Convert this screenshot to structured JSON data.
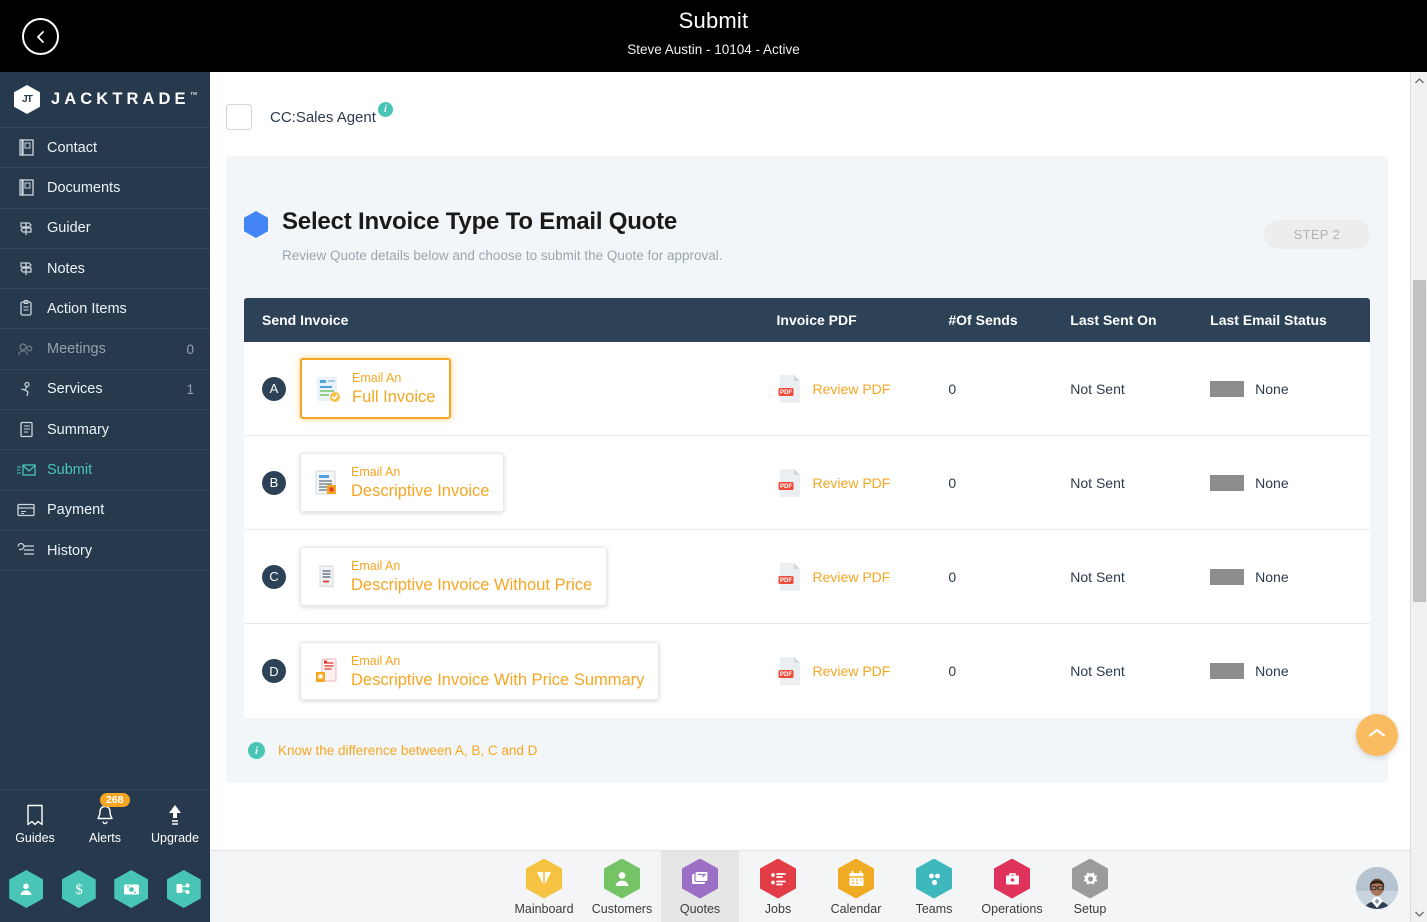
{
  "topbar": {
    "back_icon": "chevron-left-icon",
    "title": "Submit",
    "subtitle": "Steve Austin - 10104 - Active"
  },
  "sidebar": {
    "brand": "JACKTRADE",
    "brand_tm": "™",
    "items": [
      {
        "label": "Contact",
        "icon": "contact-book-icon",
        "count": "",
        "active": false,
        "dim": false
      },
      {
        "label": "Documents",
        "icon": "documents-icon",
        "count": "",
        "active": false,
        "dim": false
      },
      {
        "label": "Guider",
        "icon": "signpost-icon",
        "count": "",
        "active": false,
        "dim": false
      },
      {
        "label": "Notes",
        "icon": "signpost-icon",
        "count": "",
        "active": false,
        "dim": false
      },
      {
        "label": "Action Items",
        "icon": "clipboard-icon",
        "count": "",
        "active": false,
        "dim": false
      },
      {
        "label": "Meetings",
        "icon": "meetings-icon",
        "count": "0",
        "active": false,
        "dim": true
      },
      {
        "label": "Services",
        "icon": "services-icon",
        "count": "1",
        "active": false,
        "dim": false
      },
      {
        "label": "Summary",
        "icon": "summary-icon",
        "count": "",
        "active": false,
        "dim": false
      },
      {
        "label": "Submit",
        "icon": "submit-mail-icon",
        "count": "",
        "active": true,
        "dim": false
      },
      {
        "label": "Payment",
        "icon": "payment-card-icon",
        "count": "",
        "active": false,
        "dim": false
      },
      {
        "label": "History",
        "icon": "history-icon",
        "count": "",
        "active": false,
        "dim": false
      }
    ],
    "tools": [
      {
        "label": "Guides",
        "icon": "book-icon",
        "badge": ""
      },
      {
        "label": "Alerts",
        "icon": "bell-icon",
        "badge": "268"
      },
      {
        "label": "Upgrade",
        "icon": "arrow-up-icon",
        "badge": ""
      }
    ],
    "quick": [
      {
        "icon": "user-hex-icon"
      },
      {
        "icon": "dollar-hex-icon"
      },
      {
        "icon": "quote-hex-icon"
      },
      {
        "icon": "workflow-hex-icon"
      }
    ],
    "accent": "#49c5b6",
    "background": "#26394d"
  },
  "main": {
    "cc": {
      "label": "CC:Sales Agent",
      "checked": false,
      "info_icon": "info-icon"
    },
    "panel": {
      "hex_icon": "blue-hexagon-icon",
      "title": "Select Invoice Type To Email Quote",
      "subtitle": "Review Quote details below and choose to submit the Quote for approval.",
      "step_chip": "STEP 2"
    },
    "table": {
      "headers": {
        "send": "Send Invoice",
        "pdf": "Invoice PDF",
        "sends": "#Of Sends",
        "last_sent": "Last Sent On",
        "status": "Last Email Status"
      },
      "rows": [
        {
          "letter": "A",
          "pre": "Email An",
          "name": "Full Invoice",
          "icon": "invoice-full-icon",
          "selected": true,
          "pdf_link": "Review PDF",
          "pdf_icon": "pdf-file-icon",
          "sends": "0",
          "last_sent": "Not Sent",
          "status": "None"
        },
        {
          "letter": "B",
          "pre": "Email An",
          "name": "Descriptive Invoice",
          "icon": "invoice-descriptive-icon",
          "selected": false,
          "pdf_link": "Review PDF",
          "pdf_icon": "pdf-file-icon",
          "sends": "0",
          "last_sent": "Not Sent",
          "status": "None"
        },
        {
          "letter": "C",
          "pre": "Email An",
          "name": "Descriptive Invoice Without Price",
          "icon": "invoice-noprice-icon",
          "selected": false,
          "pdf_link": "Review PDF",
          "pdf_icon": "pdf-file-icon",
          "sends": "0",
          "last_sent": "Not Sent",
          "status": "None"
        },
        {
          "letter": "D",
          "pre": "Email An",
          "name": "Descriptive Invoice With Price Summary",
          "icon": "invoice-pricesummary-icon",
          "selected": false,
          "pdf_link": "Review PDF",
          "pdf_icon": "pdf-file-icon",
          "sends": "0",
          "last_sent": "Not Sent",
          "status": "None"
        }
      ]
    },
    "note": {
      "icon": "info-icon",
      "text": "Know the difference between A, B, C and D"
    },
    "fab": {
      "icon": "chevron-up-icon"
    }
  },
  "bottom_nav": {
    "items": [
      {
        "label": "Mainboard",
        "icon": "mainboard-icon",
        "color": "#f5c242",
        "active": false
      },
      {
        "label": "Customers",
        "icon": "customers-icon",
        "color": "#74c365",
        "active": false
      },
      {
        "label": "Quotes",
        "icon": "quotes-icon",
        "color": "#9b6fc4",
        "active": true
      },
      {
        "label": "Jobs",
        "icon": "jobs-icon",
        "color": "#e23c47",
        "active": false
      },
      {
        "label": "Calendar",
        "icon": "calendar-icon",
        "color": "#f0ab24",
        "active": false
      },
      {
        "label": "Teams",
        "icon": "teams-icon",
        "color": "#3fb8bd",
        "active": false
      },
      {
        "label": "Operations",
        "icon": "operations-icon",
        "color": "#e0335c",
        "active": false
      },
      {
        "label": "Setup",
        "icon": "setup-gear-icon",
        "color": "#9b9b9b",
        "active": false
      }
    ],
    "avatar": "user-avatar"
  },
  "scrollbar": {
    "up_icon": "caret-up-icon",
    "down_icon": "caret-down-icon"
  }
}
